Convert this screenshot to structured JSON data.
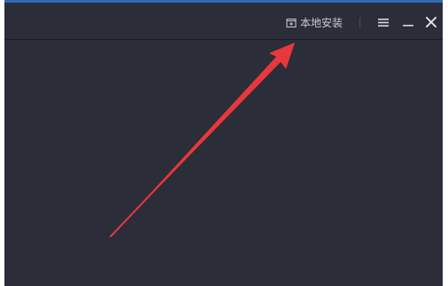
{
  "titlebar": {
    "local_install_label": "本地安装",
    "local_install_icon": "folder-add-icon",
    "menu_icon": "hamburger-menu-icon",
    "minimize_icon": "minimize-icon",
    "close_icon": "close-icon"
  },
  "colors": {
    "window_background": "#2b2d38",
    "top_accent": "#2f6bb6",
    "titlebar_text": "#c9ccd6",
    "annotation_arrow": "#e8383d"
  }
}
